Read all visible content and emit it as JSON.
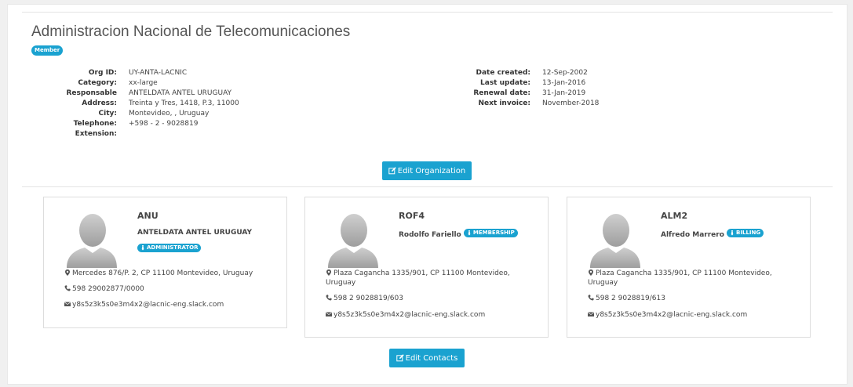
{
  "org": {
    "name": "Administracion Nacional de Telecomunicaciones",
    "badge": "Member",
    "left_fields": [
      {
        "label": "Org ID:",
        "value": "UY-ANTA-LACNIC"
      },
      {
        "label": "Category:",
        "value": "xx-large"
      },
      {
        "label": "Responsable",
        "value": "ANTELDATA ANTEL URUGUAY"
      },
      {
        "label": "Address:",
        "value": "Treinta y Tres, 1418, P.3, 11000"
      },
      {
        "label": "City:",
        "value": "Montevideo, , Uruguay"
      },
      {
        "label": "Telephone:",
        "value": "+598 - 2 - 9028819"
      },
      {
        "label": "Extension:",
        "value": ""
      }
    ],
    "right_fields": [
      {
        "label": "Date created:",
        "value": "12-Sep-2002"
      },
      {
        "label": "Last update:",
        "value": "13-Jan-2016"
      },
      {
        "label": "Renewal date:",
        "value": "31-Jan-2019"
      },
      {
        "label": "Next invoice:",
        "value": "November-2018"
      }
    ],
    "edit_button": "Edit Organization"
  },
  "contacts": [
    {
      "handle": "ANU",
      "name": "ANTELDATA ANTEL URUGUAY",
      "role": "ADMINISTRATOR",
      "address": "Mercedes 876/P. 2, CP 11100 Montevideo, Uruguay",
      "phone": "598 29002877/0000",
      "email": "y8s5z3k5s0e3m4x2@lacnic-eng.slack.com"
    },
    {
      "handle": "ROF4",
      "name": "Rodolfo Fariello",
      "role": "MEMBERSHIP",
      "address": "Plaza Cagancha 1335/901, CP 11100 Montevideo, Uruguay",
      "phone": "598 2 9028819/603",
      "email": "y8s5z3k5s0e3m4x2@lacnic-eng.slack.com"
    },
    {
      "handle": "ALM2",
      "name": "Alfredo Marrero",
      "role": "BILLING",
      "address": "Plaza Cagancha 1335/901, CP 11100 Montevideo, Uruguay",
      "phone": "598 2 9028819/613",
      "email": "y8s5z3k5s0e3m4x2@lacnic-eng.slack.com"
    }
  ],
  "edit_contacts_button": "Edit Contacts",
  "colors": {
    "accent": "#1aa2d0"
  },
  "icons": {
    "edit": "edit-icon",
    "role": "user-tie-icon",
    "address": "map-marker-icon",
    "phone": "phone-icon",
    "email": "envelope-icon",
    "avatar": "default-avatar"
  }
}
